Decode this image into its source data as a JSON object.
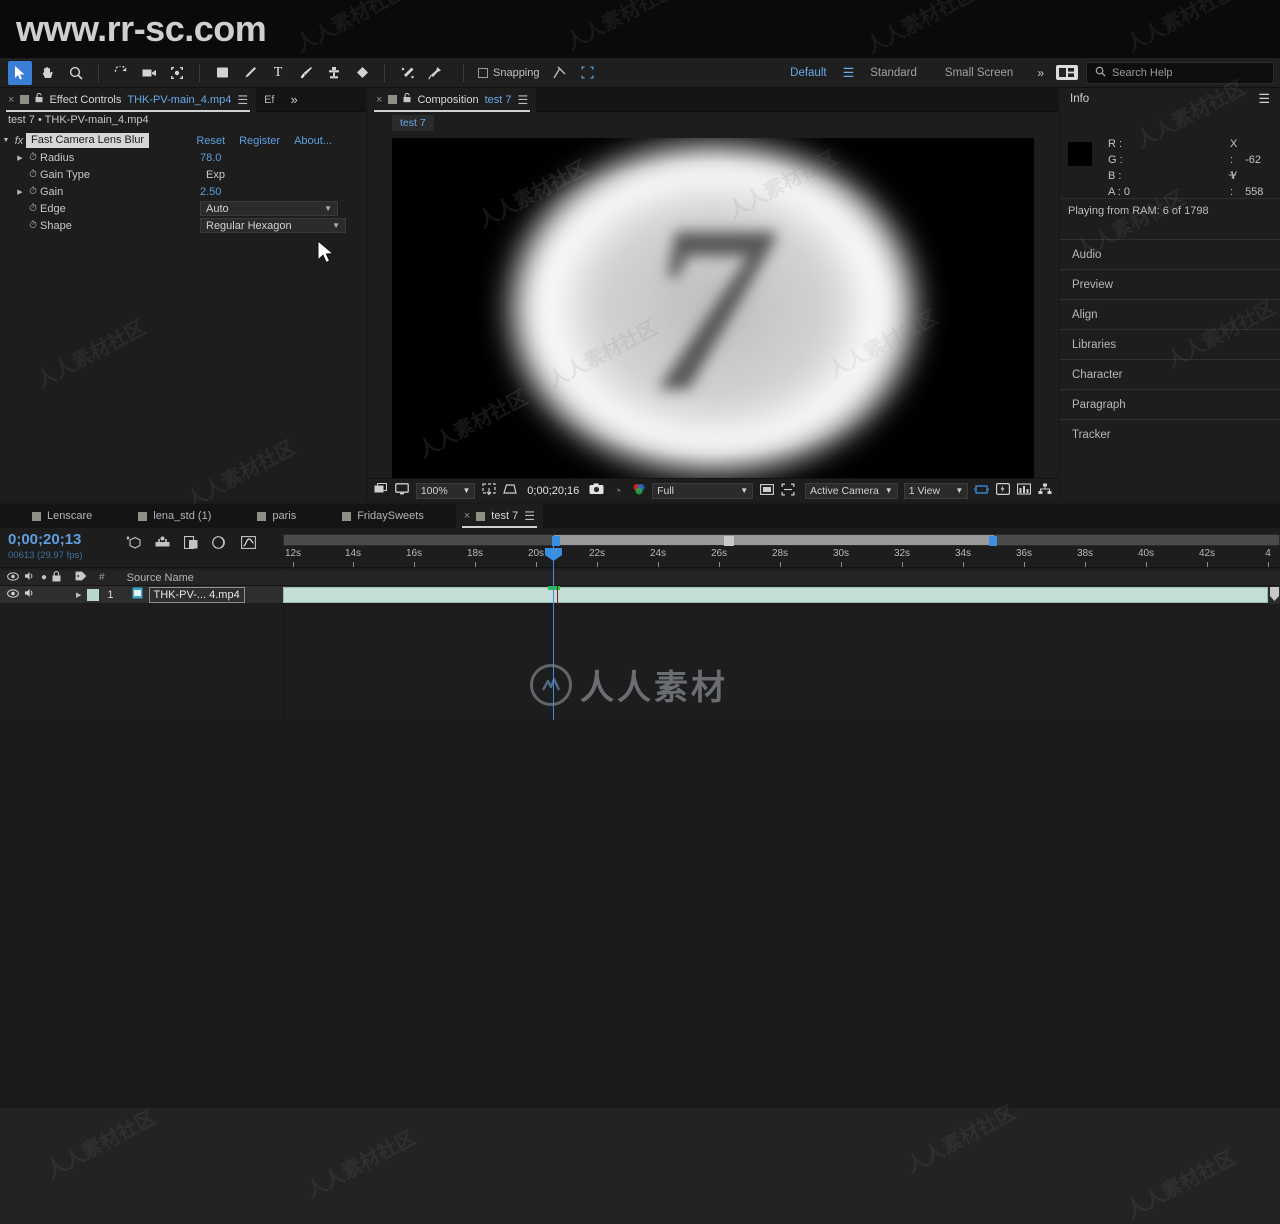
{
  "watermarks": {
    "top": "www.rr-sc.com",
    "bottom": "人人素材",
    "logo_glyph": "◠",
    "diagonal": "人人素材社区"
  },
  "toolbar": {
    "tools": [
      {
        "name": "selection-tool",
        "glyph": "➤",
        "active": true
      },
      {
        "name": "hand-tool",
        "glyph": "✋",
        "active": false
      },
      {
        "name": "zoom-tool",
        "glyph": "🔍",
        "active": false
      },
      {
        "name": "rotation-tool",
        "glyph": "↺",
        "active": false
      },
      {
        "name": "camera-tool",
        "glyph": "🎥",
        "active": false
      },
      {
        "name": "anchor-point-tool",
        "glyph": "⛶",
        "active": false
      },
      {
        "name": "shape-tool",
        "glyph": "▢",
        "active": false
      },
      {
        "name": "pen-tool",
        "glyph": "✒",
        "active": false
      },
      {
        "name": "type-tool",
        "glyph": "T",
        "active": false
      },
      {
        "name": "brush-tool",
        "glyph": "🖌",
        "active": false
      },
      {
        "name": "clone-stamp-tool",
        "glyph": "⚱",
        "active": false
      },
      {
        "name": "eraser-tool",
        "glyph": "◆",
        "active": false
      },
      {
        "name": "roto-brush-tool",
        "glyph": "𝆺",
        "active": false
      },
      {
        "name": "puppet-pin-tool",
        "glyph": "📌",
        "active": false
      }
    ],
    "snapping_label": "Snapping",
    "workspaces": [
      {
        "label": "Default",
        "selected": true
      },
      {
        "label": "Standard",
        "selected": false
      },
      {
        "label": "Small Screen",
        "selected": false
      }
    ],
    "overflow_glyph": "»",
    "search_placeholder": "Search Help",
    "search_icon": "search-icon"
  },
  "effect_controls": {
    "tab": {
      "close_glyph": "×",
      "title": "Effect Controls",
      "subject": "THK-PV-main_4.mp4",
      "menu_glyph": "☰",
      "lock_glyph": "🔓"
    },
    "extra_tab_label": "Ef",
    "overflow_glyph": "»",
    "header": "test 7 • THK-PV-main_4.mp4",
    "effect_name": "Fast Camera Lens Blur",
    "links": [
      "Reset",
      "Register",
      "About..."
    ],
    "properties": [
      {
        "name": "Radius",
        "value": "78.0",
        "type": "number",
        "expandable": true
      },
      {
        "name": "Gain Type",
        "value": "Exp",
        "type": "text",
        "expandable": false
      },
      {
        "name": "Gain",
        "value": "2.50",
        "type": "number",
        "expandable": true
      },
      {
        "name": "Edge",
        "value": "Auto",
        "type": "dropdown",
        "expandable": false
      },
      {
        "name": "Shape",
        "value": "Regular Hexagon",
        "type": "dropdown",
        "expandable": false
      }
    ]
  },
  "composition": {
    "tab": {
      "close_glyph": "×",
      "title": "Composition",
      "name": "test 7",
      "menu_glyph": "☰",
      "lock_glyph": "🔓"
    },
    "subtab": "test 7",
    "viewer": {
      "digit": "7",
      "zoom": "100%",
      "timecode": "0;00;20;16",
      "resolution": "Full",
      "camera": "Active Camera",
      "views": "1 View",
      "icons": [
        "always-preview-this-view-icon",
        "main-viewer-icon",
        "region-of-interest-icon",
        "mask-shape-icon",
        "snapshot-icon",
        "show-snapshot-icon",
        "channel-icon",
        "transparency-grid-icon",
        "toggle-mask-icon",
        "timeline-icon",
        "comp-flowchart-icon"
      ]
    }
  },
  "info_panel": {
    "title": "Info",
    "menu_glyph": "☰",
    "channels": [
      {
        "label": "R :",
        "value": ""
      },
      {
        "label": "G :",
        "value": ""
      },
      {
        "label": "B :",
        "value": ""
      },
      {
        "label": "A :",
        "value": "0"
      }
    ],
    "coords": [
      {
        "label": "X :",
        "value": "-62"
      },
      {
        "label": "Y :",
        "value": "558"
      }
    ],
    "status": "Playing from RAM: 6 of 1798",
    "stack": [
      "Audio",
      "Preview",
      "Align",
      "Libraries",
      "Character",
      "Paragraph",
      "Tracker"
    ]
  },
  "timeline": {
    "tabs": [
      {
        "label": "Lenscare",
        "active": false
      },
      {
        "label": "lena_std (1)",
        "active": false
      },
      {
        "label": "paris",
        "active": false
      },
      {
        "label": "FridaySweets",
        "active": false
      },
      {
        "label": "test 7",
        "active": true
      }
    ],
    "menu_glyph": "☰",
    "current_time": "0;00;20;13",
    "frame_info": "00613 (29.97 fps)",
    "tool_icons": [
      "composition-mini-flowchart-icon",
      "draft-3d-icon",
      "hide-shy-layers-icon",
      "frame-blending-icon",
      "graph-editor-icon"
    ],
    "columns": [
      "Source Name"
    ],
    "column_icons": [
      "eye-icon",
      "audio-icon",
      "solo-icon",
      "lock-icon",
      "label-icon",
      "index-icon"
    ],
    "ruler_labels": [
      "12s",
      "14s",
      "16s",
      "18s",
      "20s",
      "22s",
      "24s",
      "26s",
      "28s",
      "30s",
      "32s",
      "34s",
      "36s",
      "38s",
      "40s",
      "42s",
      "4"
    ],
    "layers": [
      {
        "index": "1",
        "name": "THK-PV-... 4.mp4",
        "eye_icon": "eye-icon",
        "audio_icon": "audio-icon",
        "expand_glyph": "▶",
        "label_color": "#b7d7cc",
        "source_icon": "video-footage-icon",
        "bar_color": "#c3ded6"
      }
    ]
  }
}
